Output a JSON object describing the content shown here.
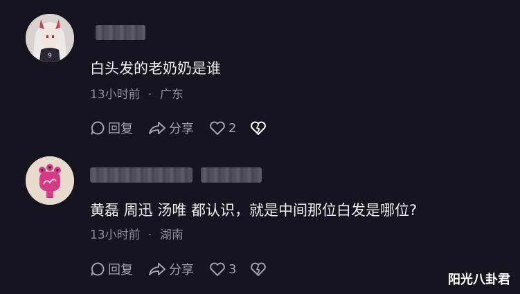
{
  "comments": [
    {
      "text": "白头发的老奶奶是谁",
      "time": "13小时前",
      "separator": "·",
      "location": "广东",
      "reply_label": "回复",
      "share_label": "分享",
      "like_count": "2",
      "avatar_icon": "anime-character-avatar-icon"
    },
    {
      "text": "黄磊 周迅 汤唯 都认识，就是中间那位白发是哪位?",
      "time": "13小时前",
      "separator": "·",
      "location": "湖南",
      "reply_label": "回复",
      "share_label": "分享",
      "like_count": "3",
      "avatar_icon": "pink-creature-avatar-icon"
    }
  ],
  "watermark": "阳光八卦君",
  "colors": {
    "background": "#16151f",
    "text": "#eeeeef",
    "meta": "#8e8d96",
    "action": "#a4a3ab"
  }
}
